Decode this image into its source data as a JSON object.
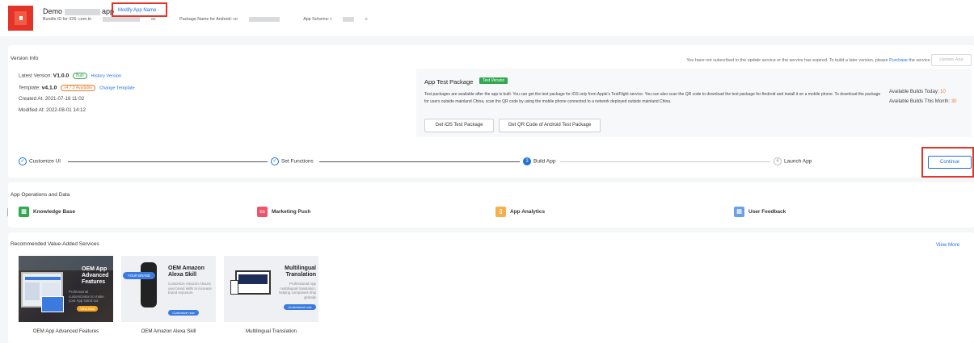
{
  "header": {
    "app_name": "Demo",
    "app_name_suffix": "app",
    "modify_link": "Modify App Name",
    "bundle_label": "Bundle ID for iOS: com.te",
    "bundle_suffix": "oc",
    "package_label": "Package Name for Android: co",
    "schema_label": "App Schema: t",
    "schema_suffix": "c"
  },
  "version": {
    "title": "Version Info",
    "subscription_notice_pre": "You have not subscribed to the update service or the service has expired. To build a later version, please",
    "subscription_link": "Purchase",
    "subscription_notice_post": "the service.",
    "update_button": "Update App",
    "latest_label": "Latest Version:",
    "latest_value": "V1.0.0",
    "latest_tag": "Built",
    "history_link": "History Version",
    "template_label": "Template:",
    "template_value": "v4.1.0",
    "template_tag": "v4.7.0 Available",
    "change_template_link": "Change Template",
    "created_label": "Created At:",
    "created_value": "2021-07-16 11:02",
    "modified_label": "Modified At:",
    "modified_value": "2022-08-01 14:12"
  },
  "test": {
    "title": "App Test Package",
    "tag": "Test Version",
    "desc": "Test packages are available after the app is built. You can get the test package for iOS only from Apple's TestFlight service. You can also scan the QR code to download the test package for Android and install it on a mobile phone. To download the package for users outside mainland China, scan the QR code by using the mobile phone connected to a network deployed outside mainland China.",
    "ios_button": "Get iOS Test Package",
    "android_button": "Get QR Code of Android Test Package",
    "today_label": "Available Builds Today:",
    "today_value": "10",
    "month_label": "Available Builds This Month:",
    "month_value": "30"
  },
  "steps": {
    "items": [
      {
        "label": "Customize UI",
        "mark": "✓"
      },
      {
        "label": "Set Functions",
        "mark": "✓"
      },
      {
        "label": "Build App",
        "mark": "3"
      },
      {
        "label": "Launch App",
        "mark": "4"
      }
    ],
    "continue_button": "Continue"
  },
  "ops": {
    "title": "App Operations and Data",
    "items": [
      {
        "label": "Knowledge Base",
        "color": "#2fa84f",
        "icon": "book-icon"
      },
      {
        "label": "Marketing Push",
        "color": "#f0546a",
        "icon": "megaphone-icon"
      },
      {
        "label": "App Analytics",
        "color": "#f5b04a",
        "icon": "phone-icon"
      },
      {
        "label": "User Feedback",
        "color": "#6aa0e8",
        "icon": "feedback-icon"
      }
    ]
  },
  "services": {
    "title": "Recommended Value-Added Services",
    "view_more": "View More",
    "items": [
      {
        "banner_title": "OEM App Advanced Features",
        "banner_desc": "Professional customization to make your App stand out",
        "banner_button": "View Now",
        "caption": "OEM App Advanced Features"
      },
      {
        "banner_title": "OEM Amazon Alexa Skill",
        "banner_badge": "YOUR BRAND",
        "banner_desc": "Customize Amazon Alexa's own brand skills to increase brand exposure",
        "banner_button": "Customize now",
        "caption": "OEM Amazon Alexa Skill"
      },
      {
        "banner_title": "Multilingual Translation",
        "banner_desc": "Professional App multilingual translation, helping companies ship globally",
        "banner_button": "Understand now",
        "caption": "Multilingual Translation"
      }
    ]
  }
}
